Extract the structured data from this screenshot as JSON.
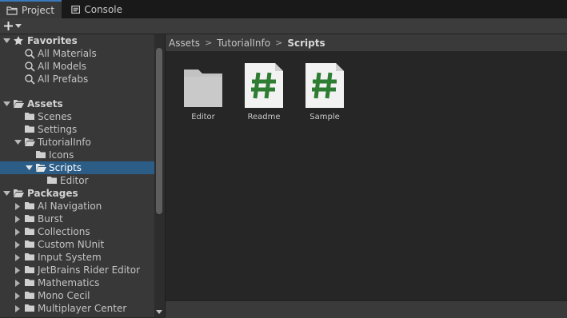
{
  "tabs": [
    {
      "label": "Project",
      "icon": "folder-icon",
      "active": true
    },
    {
      "label": "Console",
      "icon": "console-icon",
      "active": false
    }
  ],
  "toolbar": {
    "create_icon": "plus-icon",
    "dropdown_icon": "chevron-down-icon"
  },
  "tree": {
    "favorites": {
      "label": "Favorites",
      "icon": "star-icon",
      "items": [
        "All Materials",
        "All Models",
        "All Prefabs"
      ]
    },
    "assets": {
      "label": "Assets",
      "children": [
        {
          "label": "Scenes"
        },
        {
          "label": "Settings"
        },
        {
          "label": "TutorialInfo"
        },
        {
          "label": "Icons"
        },
        {
          "label": "Scripts",
          "selected": true
        },
        {
          "label": "Editor"
        }
      ]
    },
    "packages": {
      "label": "Packages",
      "children": [
        {
          "label": "AI Navigation"
        },
        {
          "label": "Burst"
        },
        {
          "label": "Collections"
        },
        {
          "label": "Custom NUnit"
        },
        {
          "label": "Input System"
        },
        {
          "label": "JetBrains Rider Editor"
        },
        {
          "label": "Mathematics"
        },
        {
          "label": "Mono Cecil"
        },
        {
          "label": "Multiplayer Center"
        }
      ]
    }
  },
  "breadcrumb": [
    "Assets",
    "TutorialInfo",
    "Scripts"
  ],
  "grid_items": [
    {
      "label": "Editor",
      "type": "folder"
    },
    {
      "label": "Readme",
      "type": "script",
      "glyph": "#"
    },
    {
      "label": "Sample",
      "type": "script",
      "glyph": "#"
    }
  ],
  "colors": {
    "selection": "#2c5d87",
    "tab_accent": "#3a79bb",
    "script_hash": "#2e7d32",
    "folder": "#c2c2c2"
  }
}
